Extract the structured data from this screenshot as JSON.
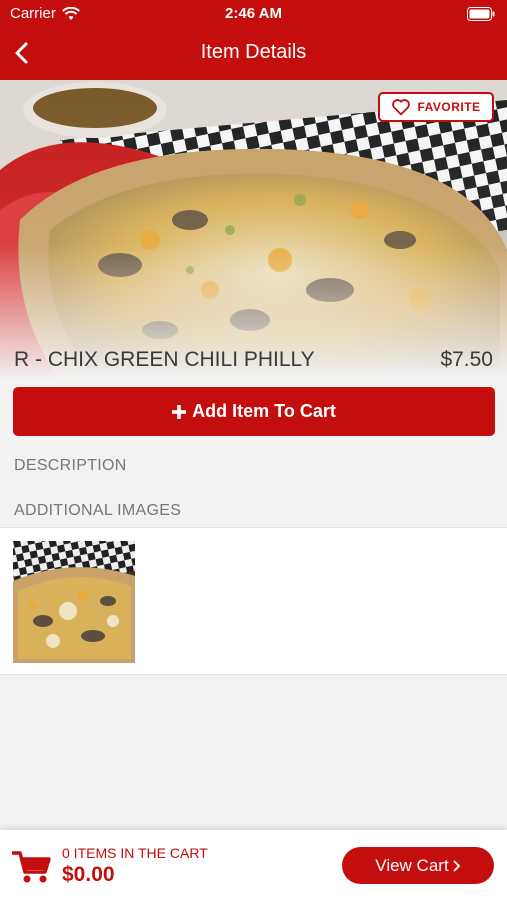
{
  "status_bar": {
    "carrier": "Carrier",
    "time": "2:46 AM"
  },
  "nav": {
    "title": "Item Details"
  },
  "favorite": {
    "label": "FAVORITE"
  },
  "item": {
    "name": "R - CHIX GREEN CHILI PHILLY",
    "price": "$7.50"
  },
  "add_to_cart": {
    "icon": "plus-icon",
    "label": "Add Item To Cart"
  },
  "sections": {
    "description": "DESCRIPTION",
    "additional_images": "ADDITIONAL IMAGES"
  },
  "cart": {
    "count_text": "0 ITEMS IN THE CART",
    "total": "$0.00",
    "view_label": "View Cart",
    "view_icon": "chevron-right-icon"
  },
  "colors": {
    "brand": "#c40d0d",
    "background": "#f2f2f2"
  }
}
